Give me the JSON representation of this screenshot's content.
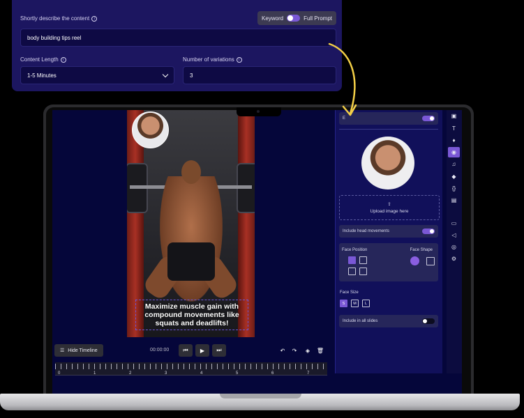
{
  "form": {
    "describe_label": "Shortly describe the content",
    "mode_keyword": "Keyword",
    "mode_full": "Full Prompt",
    "describe_value": "body building tips reel",
    "length_label": "Content Length",
    "length_value": "1-5 Minutes",
    "variations_label": "Number of variations",
    "variations_value": "3"
  },
  "editor": {
    "caption": "Maximize muscle gain with compound movements like squats and deadlifts!",
    "hide_timeline": "Hide Timeline",
    "time": "00:00:00",
    "ruler_marks": [
      "0",
      "1",
      "2",
      "3",
      "4",
      "5",
      "6",
      "7"
    ]
  },
  "panel": {
    "top_toggle_label": "E",
    "upload_label": "Upload image here",
    "head_movements": "Include head movements",
    "face_position": "Face Position",
    "face_shape": "Face Shape",
    "face_size": "Face Size",
    "sizes": [
      "S",
      "M",
      "L"
    ],
    "include_all": "Include in all slides"
  },
  "colors": {
    "accent": "#7a58d6",
    "form_bg": "#1c1660",
    "screen_bg": "#05063a",
    "arrow": "#f3cf47"
  }
}
